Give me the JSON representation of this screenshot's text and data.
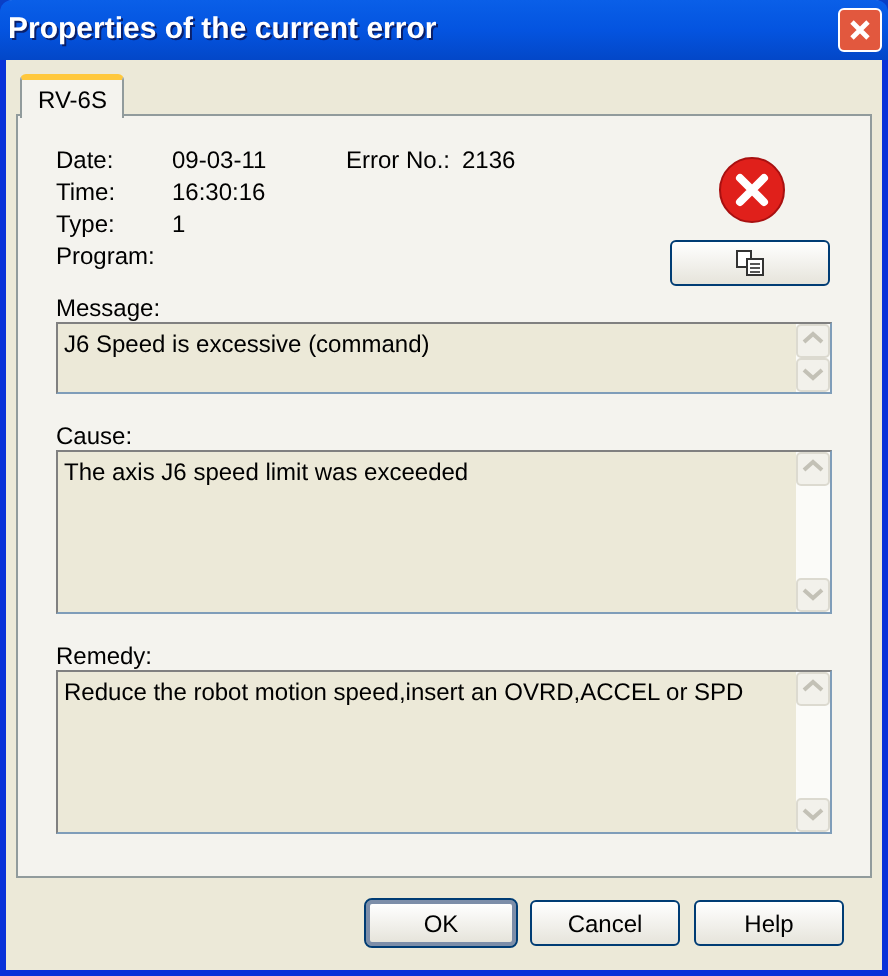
{
  "window": {
    "title": "Properties of the current error"
  },
  "tabs": [
    {
      "label": "RV-6S",
      "selected": true
    }
  ],
  "details": [
    {
      "label": "Date:",
      "value": "09-03-11"
    },
    {
      "label": "Time:",
      "value": "16:30:16"
    },
    {
      "label": "Type:",
      "value": "1"
    },
    {
      "label": "Program:"
    }
  ],
  "error_no": {
    "label": "Error No.:",
    "value": "2136"
  },
  "sections": [
    {
      "label": "Message:",
      "text": "J6 Speed is excessive (command)"
    },
    {
      "label": "Cause:",
      "text": "The axis J6 speed limit was exceeded"
    },
    {
      "label": "Remedy:",
      "text": "Reduce the robot motion speed,insert an OVRD,ACCEL or SPD"
    }
  ],
  "buttons": [
    {
      "label": "OK",
      "default": true
    },
    {
      "label": "Cancel",
      "default": false
    },
    {
      "label": "Help",
      "default": false
    }
  ]
}
